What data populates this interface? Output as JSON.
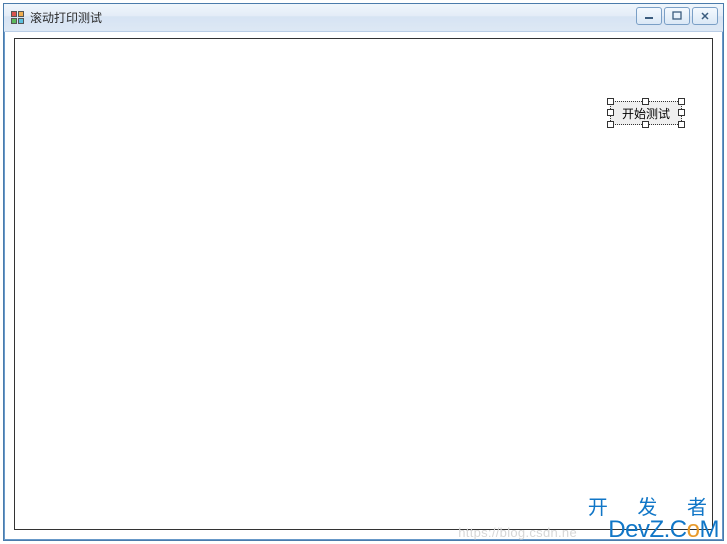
{
  "window": {
    "title": "滚动打印测试"
  },
  "button": {
    "label": "开始测试"
  },
  "watermark": {
    "url": "https://blog.csdn.ne",
    "brand_cn": "开 发 者",
    "brand_en_pre": "DevZ.C",
    "brand_en_o": "o",
    "brand_en_post": "M"
  }
}
